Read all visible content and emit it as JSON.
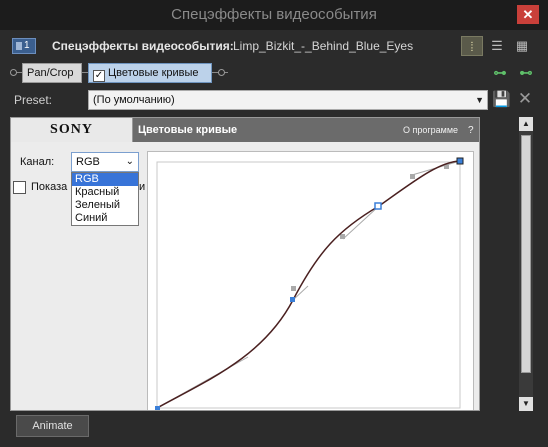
{
  "window": {
    "title": "Спецэффекты видеособытия",
    "close_glyph": "✕"
  },
  "header": {
    "chain_badge": "1",
    "fx_title": "Спецэффекты видеособытия:",
    "event_name": "Limp_Bizkit_-_Behind_Blue_Eyes",
    "view_icons": [
      "list-detail-icon",
      "list-icon",
      "grid-icon"
    ]
  },
  "chain": {
    "plugins": [
      {
        "label": "Pan/Crop",
        "active": false
      },
      {
        "label": "Цветовые кривые",
        "active": true,
        "checked": true
      }
    ]
  },
  "preset": {
    "label": "Preset:",
    "value": "(По умолчанию)"
  },
  "panel": {
    "brand": "SONY",
    "plugin_name": "Цветовые кривые",
    "about": "О программе",
    "help": "?",
    "channel_label": "Канал:",
    "channel_value": "RGB",
    "channel_options": [
      "RGB",
      "Красный",
      "Зеленый",
      "Синий"
    ],
    "show_label": "Показа",
    "show_label_tail": "и"
  },
  "curve": {
    "points": [
      [
        0,
        0
      ],
      [
        0.4,
        0.45
      ],
      [
        0.68,
        0.83
      ],
      [
        1,
        1
      ]
    ],
    "curve_color": "#4a2020",
    "handle_color": "#3a7fd8"
  },
  "footer": {
    "animate": "Animate"
  },
  "colors": {
    "accent": "#3874d8",
    "close": "#c9403a",
    "title": "#8a8a8a"
  }
}
